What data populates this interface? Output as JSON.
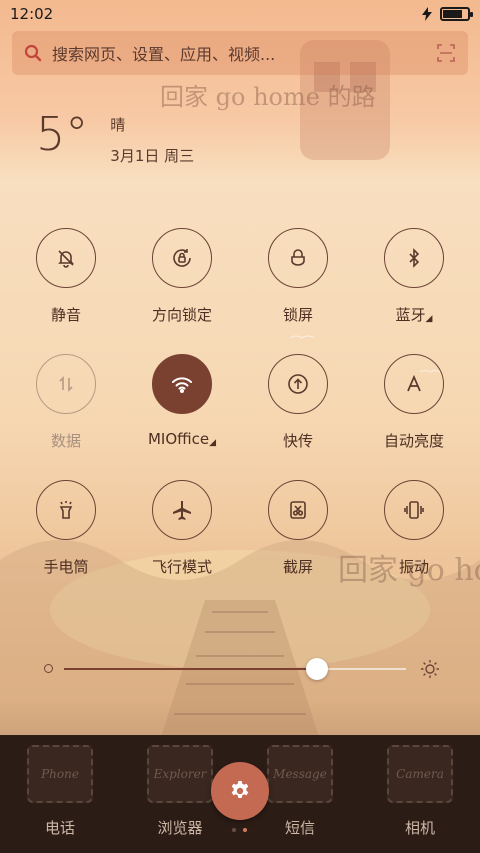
{
  "status_bar": {
    "time": "12:02",
    "battery_level": 0.8
  },
  "search": {
    "placeholder": "搜索网页、设置、应用、视频..."
  },
  "weather": {
    "temperature": "5°",
    "condition": "晴",
    "date": "3月1日 周三"
  },
  "quick_settings": [
    {
      "label": "静音",
      "icon": "bell-off-icon",
      "state": "normal"
    },
    {
      "label": "方向锁定",
      "icon": "rotation-lock-icon",
      "state": "normal"
    },
    {
      "label": "锁屏",
      "icon": "lock-icon",
      "state": "normal"
    },
    {
      "label": "蓝牙",
      "icon": "bluetooth-icon",
      "state": "normal",
      "has_menu": true
    },
    {
      "label": "数据",
      "icon": "mobile-data-icon",
      "state": "disabled"
    },
    {
      "label": "MIOffice",
      "icon": "wifi-icon",
      "state": "active",
      "has_menu": true
    },
    {
      "label": "快传",
      "icon": "transfer-icon",
      "state": "normal"
    },
    {
      "label": "自动亮度",
      "icon": "auto-brightness-icon",
      "state": "normal"
    },
    {
      "label": "手电筒",
      "icon": "flashlight-icon",
      "state": "normal"
    },
    {
      "label": "飞行模式",
      "icon": "airplane-icon",
      "state": "normal"
    },
    {
      "label": "截屏",
      "icon": "screenshot-icon",
      "state": "normal"
    },
    {
      "label": "振动",
      "icon": "vibrate-icon",
      "state": "normal"
    }
  ],
  "brightness": {
    "level": 0.74
  },
  "dock": {
    "apps": [
      {
        "label": "电话",
        "stamp": "Phone"
      },
      {
        "label": "浏览器",
        "stamp": "Explorer"
      },
      {
        "label": "短信",
        "stamp": "Message"
      },
      {
        "label": "相机",
        "stamp": "Camera"
      }
    ],
    "settings_icon": "gear-icon",
    "page_indicator": {
      "pages": 2,
      "current": 2
    }
  },
  "wallpaper": {
    "text_top": "回家 go home 的路",
    "text_bottom": "回家 go home"
  },
  "colors": {
    "accent": "#7a4131",
    "dock": "#2c1c16",
    "settings_button": "#c46a52"
  }
}
